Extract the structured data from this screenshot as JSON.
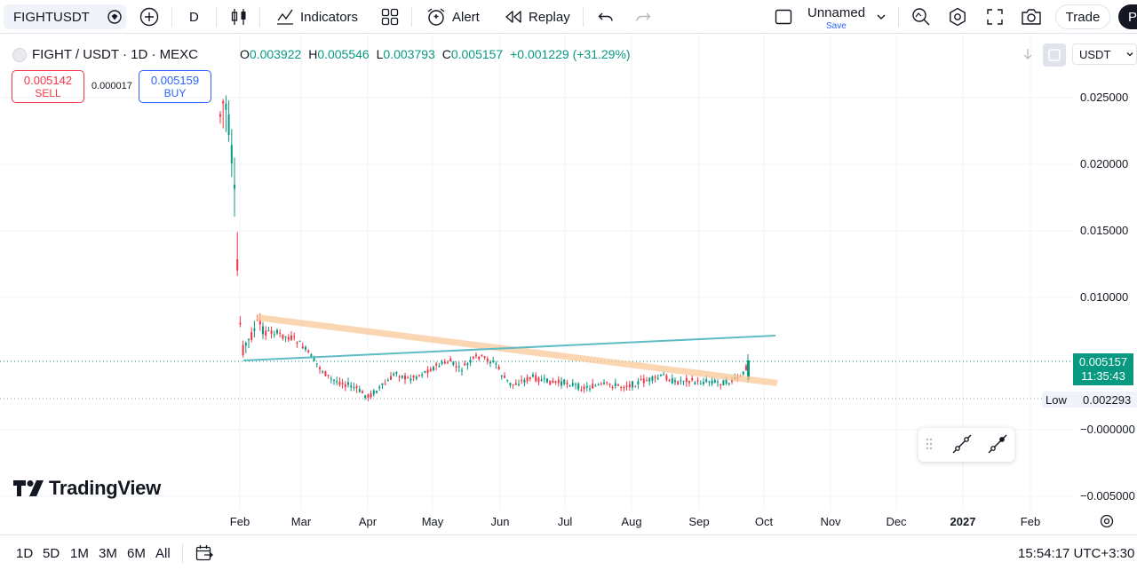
{
  "toolbar": {
    "symbol": "FIGHTUSDT",
    "interval": "D",
    "indicators_label": "Indicators",
    "alert_label": "Alert",
    "replay_label": "Replay",
    "layout_name": "Unnamed",
    "layout_save": "Save",
    "trade_label": "Trade",
    "publish_label": "P"
  },
  "legend": {
    "title": "FIGHT / USDT · 1D · MEXC",
    "o_key": "O",
    "o_val": "0.003922",
    "h_key": "H",
    "h_val": "0.005546",
    "l_key": "L",
    "l_val": "0.003793",
    "c_key": "C",
    "c_val": "0.005157",
    "change": "+0.001229 (+31.29%)"
  },
  "trade_panel": {
    "sell_price": "0.005142",
    "sell_label": "SELL",
    "spread": "0.000017",
    "buy_price": "0.005159",
    "buy_label": "BUY"
  },
  "price_scale": {
    "currency": "USDT",
    "labels": [
      "0.025000",
      "0.020000",
      "0.015000",
      "0.010000",
      "−0.000000",
      "−0.005000"
    ],
    "last_price": "0.005157",
    "countdown": "11:35:43",
    "low_label": "Low",
    "low_value": "0.002293"
  },
  "time_axis": [
    "Feb",
    "Mar",
    "Apr",
    "May",
    "Jun",
    "Jul",
    "Aug",
    "Sep",
    "Oct",
    "Nov",
    "Dec",
    "2027",
    "Feb"
  ],
  "brand": "TradingView",
  "bottom": {
    "ranges": [
      "1D",
      "5D",
      "1M",
      "3M",
      "6M",
      "All"
    ],
    "clock": "15:54:17 UTC+3:30"
  },
  "colors": {
    "up": "#089981",
    "down": "#f23645",
    "accent": "#2962ff",
    "trendline_upper": "#5ebcc4",
    "trendline_band": "#f9c89a"
  }
}
